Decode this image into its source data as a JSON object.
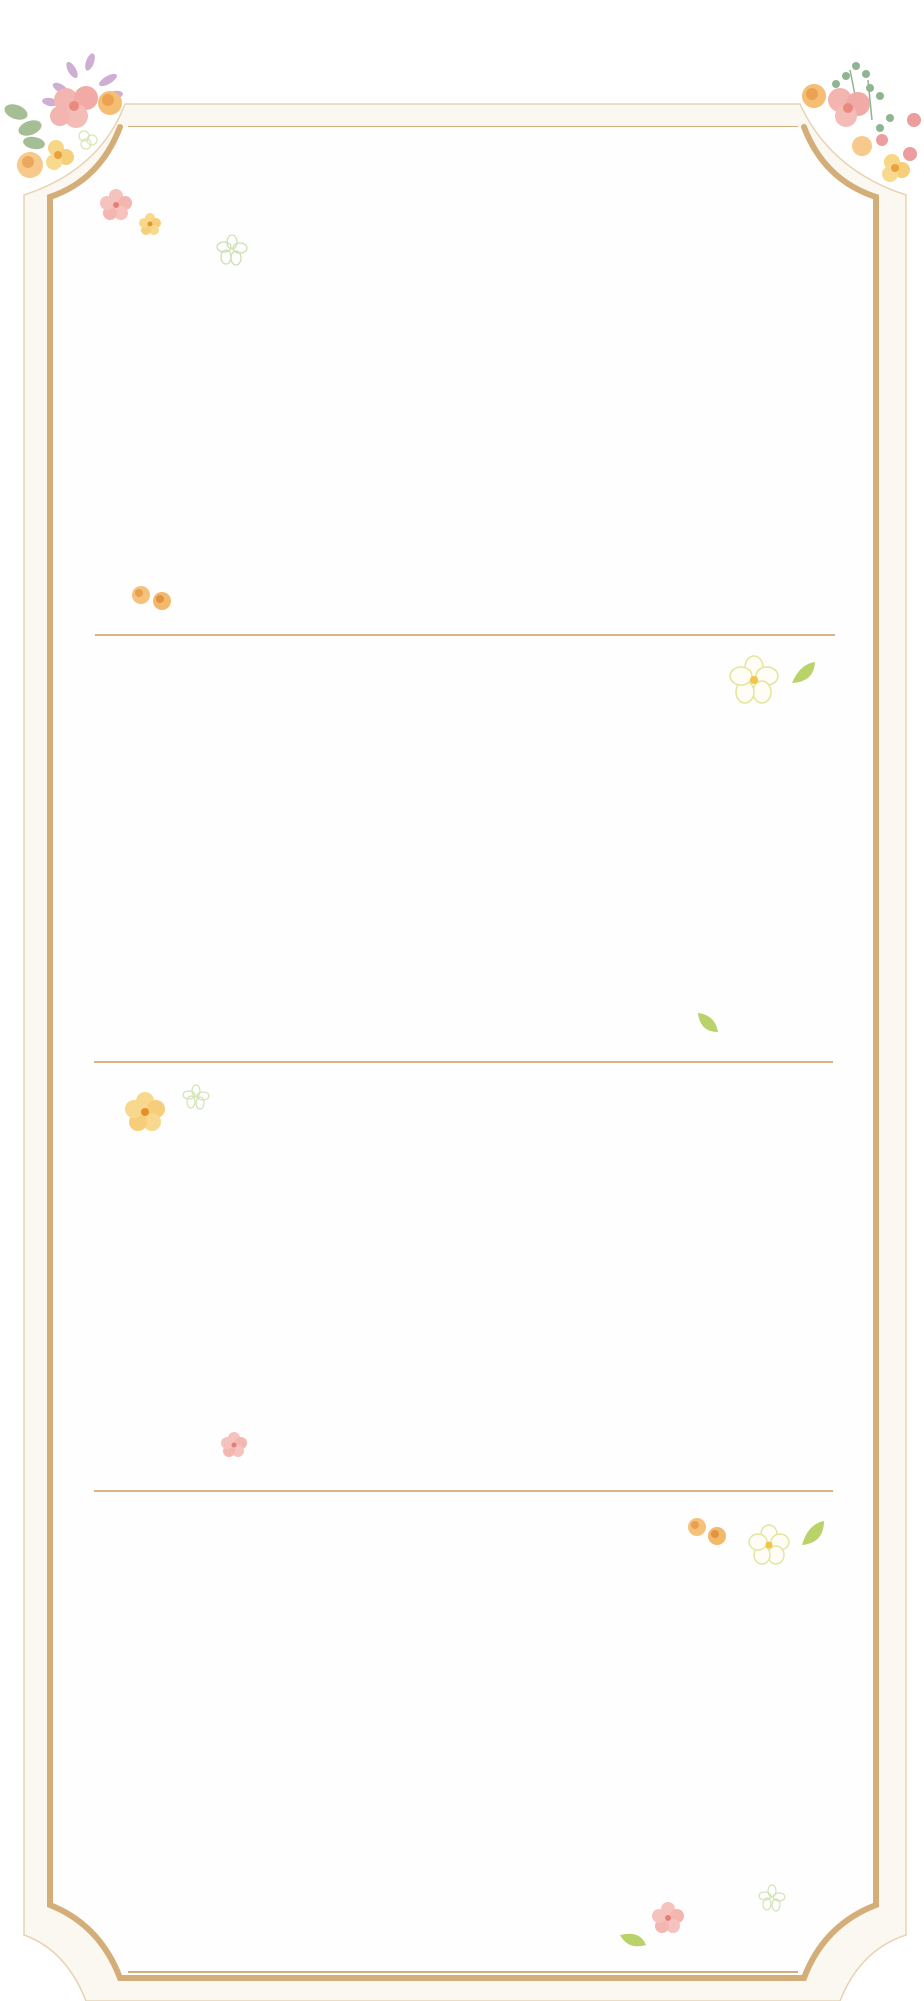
{
  "page": {
    "background": "#ffffff",
    "panel_fill": "#fefdfb",
    "frame_color": "#d4ae78",
    "outer_border_color": "#e7d3b4",
    "divider_color": "#d9b585",
    "section_count": 4
  },
  "decorations": {
    "corner_bouquets": [
      "pink-flower",
      "lavender-sprig",
      "orange-rose",
      "green-leaf",
      "yellow-flower"
    ],
    "scattered_flowers": [
      "pink-blossom",
      "yellow-blossom",
      "green-outline-flower",
      "orange-buds",
      "green-leaf",
      "yellow-outline-flower"
    ]
  }
}
